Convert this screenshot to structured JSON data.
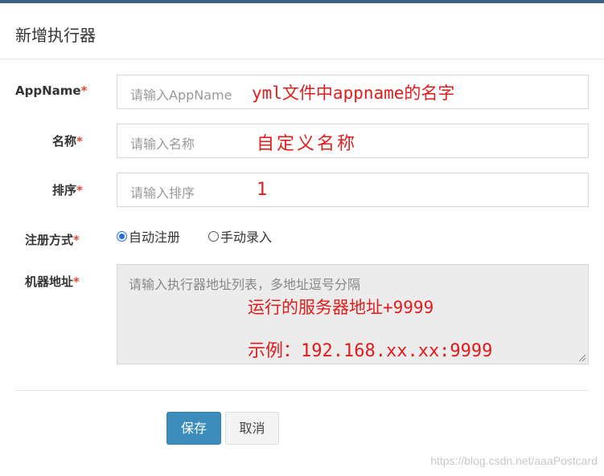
{
  "dialog": {
    "title": "新增执行器"
  },
  "form": {
    "required_mark": "*",
    "appname": {
      "label": "AppName",
      "placeholder": "请输入AppName",
      "annotation": "yml文件中appname的名字"
    },
    "name": {
      "label": "名称",
      "placeholder": "请输入名称",
      "annotation": "自定义名称"
    },
    "order": {
      "label": "排序",
      "placeholder": "请输入排序",
      "annotation": "1"
    },
    "register_type": {
      "label": "注册方式",
      "options": [
        {
          "label": "自动注册",
          "selected": true
        },
        {
          "label": "手动录入",
          "selected": false
        }
      ]
    },
    "address": {
      "label": "机器地址",
      "placeholder": "请输入执行器地址列表，多地址逗号分隔",
      "annotation_line1": "运行的服务器地址+9999",
      "annotation_line2": "示例：192.168.xx.xx:9999"
    }
  },
  "buttons": {
    "save": "保存",
    "cancel": "取消"
  },
  "watermark": "https://blog.csdn.net/aaaPostcard",
  "colors": {
    "primary": "#3c8dbc",
    "required": "#dd4b39",
    "annotation": "#e31b1b",
    "radio_selected": "#1f6fe0"
  }
}
